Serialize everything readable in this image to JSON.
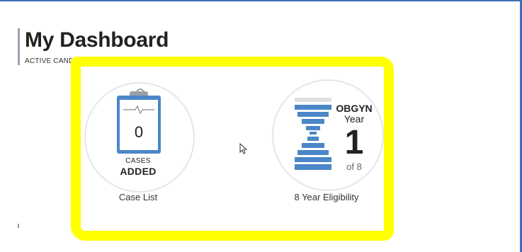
{
  "header": {
    "title": "My Dashboard",
    "subtitle": "ACTIVE CANDIDATE"
  },
  "cases_card": {
    "count": "0",
    "caption_small": "CASES",
    "caption_big": "ADDED",
    "label": "Case List",
    "icon": "clipboard-icon"
  },
  "eligibility_card": {
    "specialty": "OBGYN",
    "year_label": "Year",
    "year_number": "1",
    "year_total": "of 8",
    "label": "8 Year Eligibility",
    "icon": "hourglass-icon"
  },
  "colors": {
    "accent": "#4a86c8",
    "highlight": "#ffff00",
    "frame": "#3f6fb5"
  }
}
